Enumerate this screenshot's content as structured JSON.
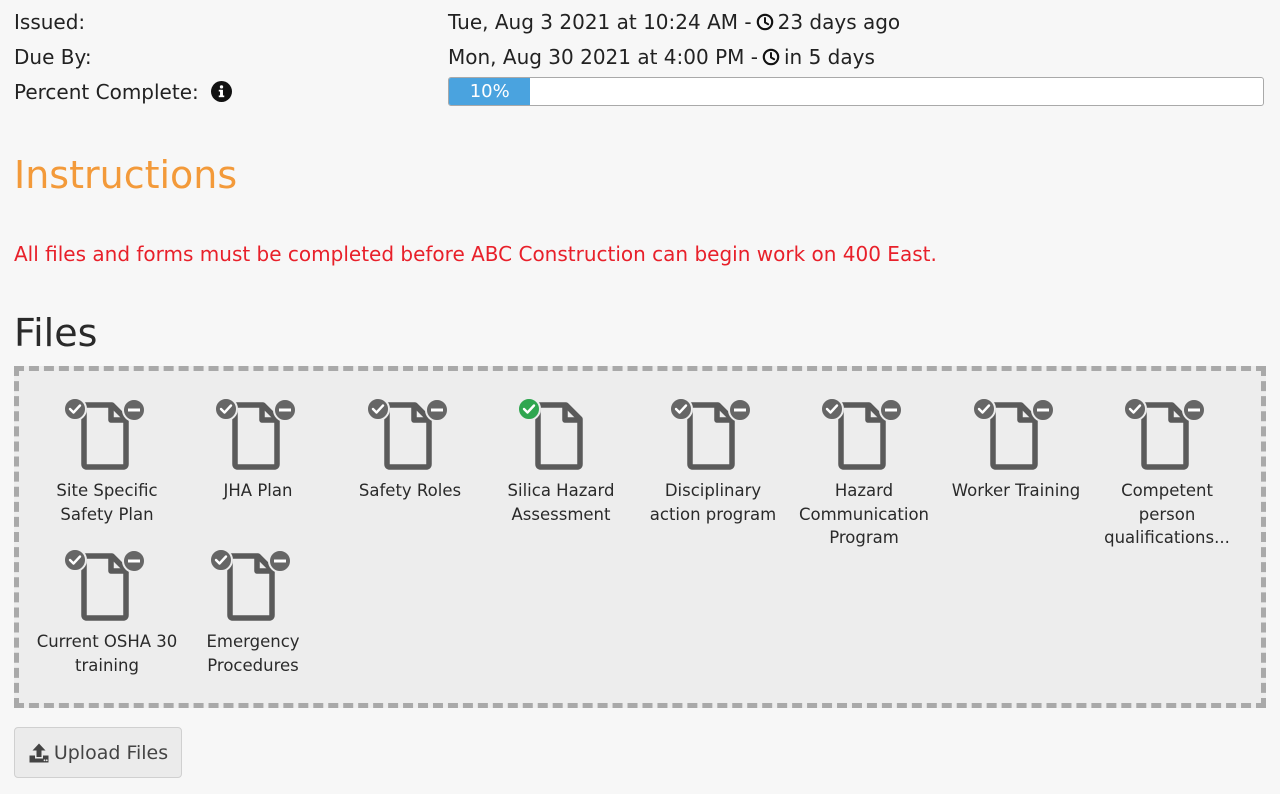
{
  "details": {
    "issued": {
      "label": "Issued:",
      "date": "Tue, Aug 3 2021 at 10:24 AM -",
      "relative": "23 days ago"
    },
    "due_by": {
      "label": "Due By:",
      "date": "Mon, Aug 30 2021 at 4:00 PM -",
      "relative": "in 5 days"
    },
    "percent_complete": {
      "label": "Percent Complete:",
      "value": 10,
      "value_text": "10%"
    }
  },
  "instructions": {
    "heading": "Instructions",
    "text": "All files and forms must be completed before ABC Construction can begin work on 400 East."
  },
  "files": {
    "heading": "Files",
    "items": [
      {
        "name": "Site Specific Safety Plan",
        "status": "pending"
      },
      {
        "name": "JHA Plan",
        "status": "pending"
      },
      {
        "name": "Safety Roles",
        "status": "pending"
      },
      {
        "name": "Silica Hazard Assessment",
        "status": "complete"
      },
      {
        "name": "Disciplinary action program",
        "status": "pending"
      },
      {
        "name": "Hazard Communication Program",
        "status": "pending"
      },
      {
        "name": "Worker Training",
        "status": "pending"
      },
      {
        "name": "Competent person qualifications...",
        "status": "pending"
      },
      {
        "name": "Current OSHA 30 training",
        "status": "pending"
      },
      {
        "name": "Emergency Procedures",
        "status": "pending"
      }
    ]
  },
  "upload_button": {
    "label": "Upload Files",
    "icon": "upload-icon"
  },
  "colors": {
    "instructions_heading": "#f39a3a",
    "instructions_text": "#e8202a",
    "progress_fill": "#4aa3df",
    "complete_badge": "#2fa64f",
    "pending_badge": "#666666"
  }
}
